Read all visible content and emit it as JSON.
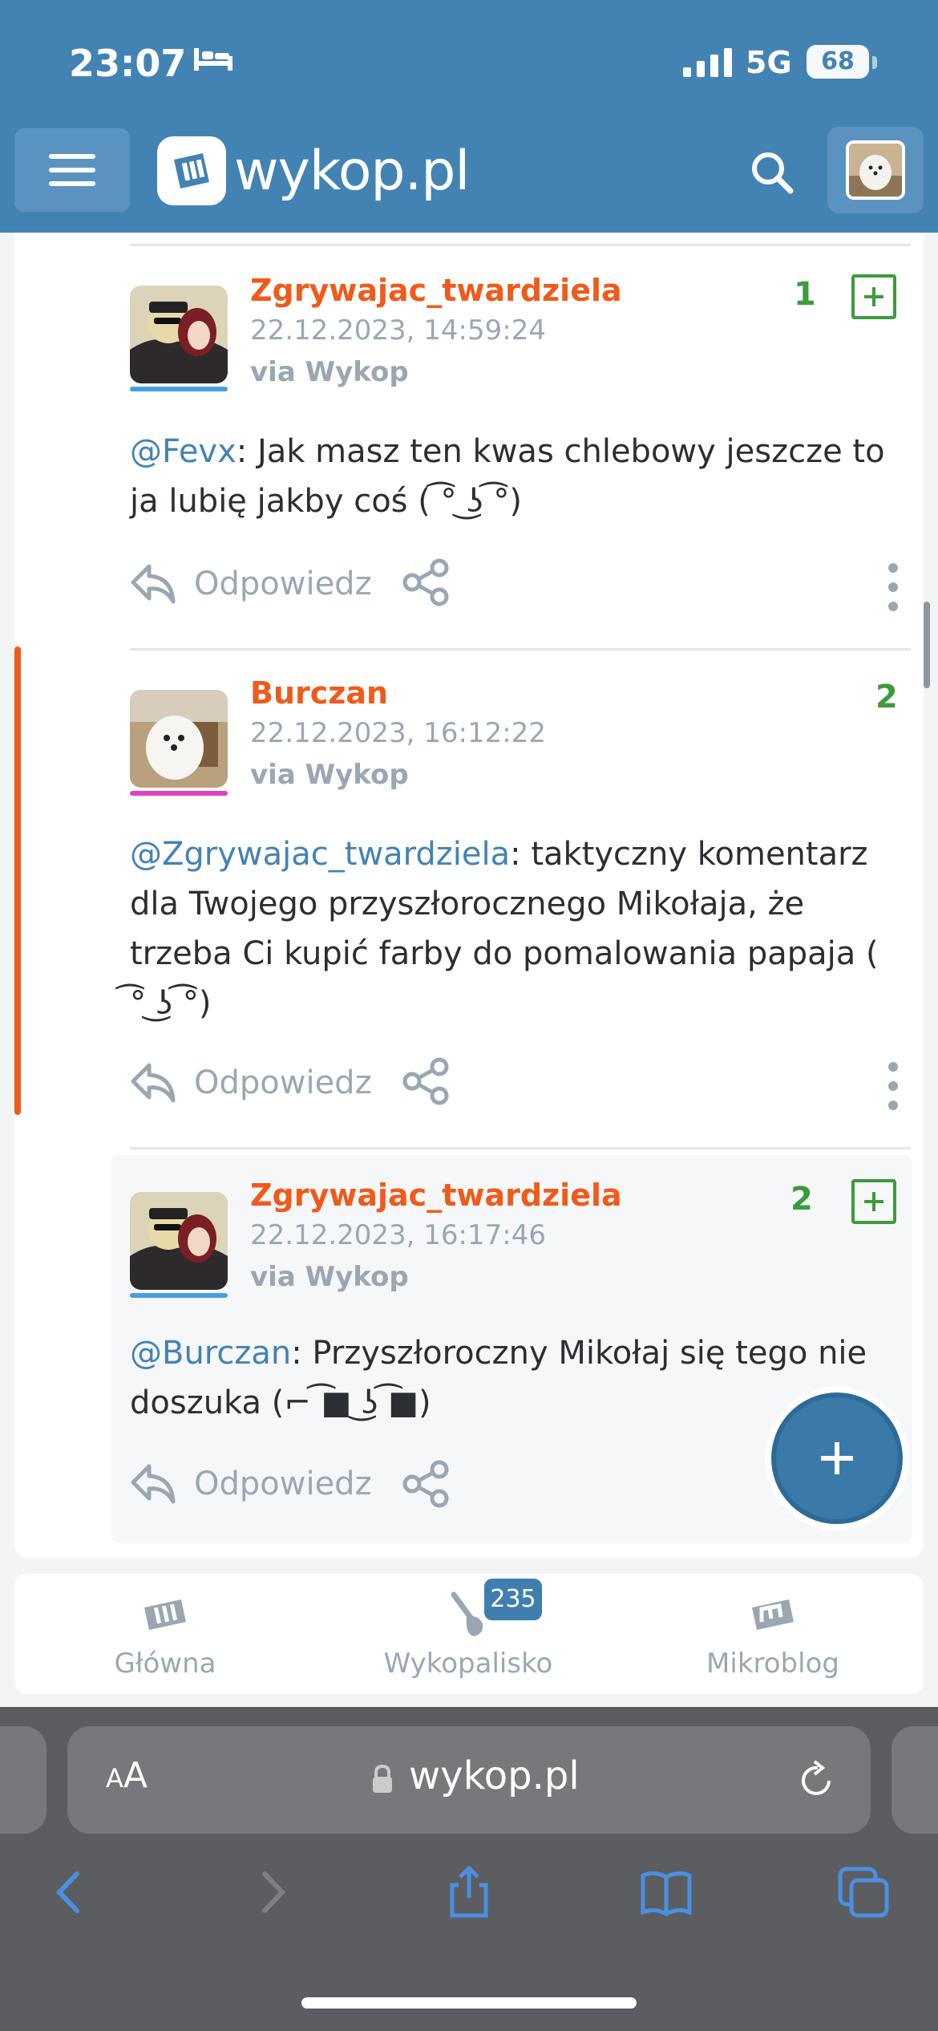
{
  "status_bar": {
    "time": "23:07",
    "network": "5G",
    "battery": "68"
  },
  "header": {
    "brand": "wykop.pl"
  },
  "comments": [
    {
      "username": "Zgrywajac_twardziela",
      "date": "22.12.2023, 14:59:24",
      "via": "via Wykop",
      "votes": "1",
      "mention": "@Fevx",
      "text_line1": ": Jak masz ten kwas chlebowy jeszcze to",
      "text_line2": "ja lubię jakby coś ( ͡° ͜ʖ ͡°)",
      "reply_label": "Odpowiedz"
    },
    {
      "username": "Burczan",
      "date": "22.12.2023, 16:12:22",
      "via": "via Wykop",
      "votes": "2",
      "mention": "@Zgrywajac_twardziela",
      "text_line1": ": taktyczny komentarz",
      "text_line2": "dla Twojego przyszłorocznego Mikołaja, że",
      "text_line3": "trzeba Ci kupić farby do pomalowania papaja (",
      "text_line4": " ͡° ͜ʖ ͡°)",
      "reply_label": "Odpowiedz"
    },
    {
      "username": "Zgrywajac_twardziela",
      "date": "22.12.2023, 16:17:46",
      "via": "via Wykop",
      "votes": "2",
      "mention": "@Burczan",
      "text_line1": ": Przyszłoroczny Mikołaj się tego nie",
      "text_line2": "doszuka (⌐ ͡■ ͜ʖ ͡■)",
      "reply_label": "Odpowiedz"
    }
  ],
  "bottom_nav": {
    "items": [
      {
        "label": "Główna",
        "icon": "home-logo-icon"
      },
      {
        "label": "Wykopalisko",
        "icon": "shovel-icon",
        "badge": "235"
      },
      {
        "label": "Mikroblog",
        "icon": "mikroblog-logo-icon"
      }
    ]
  },
  "safari": {
    "aa": "AA",
    "url": "wykop.pl"
  },
  "colors": {
    "header": "#4383b4",
    "username": "#f05a1a",
    "vote": "#3c9b3c",
    "mention": "#4383b4"
  }
}
